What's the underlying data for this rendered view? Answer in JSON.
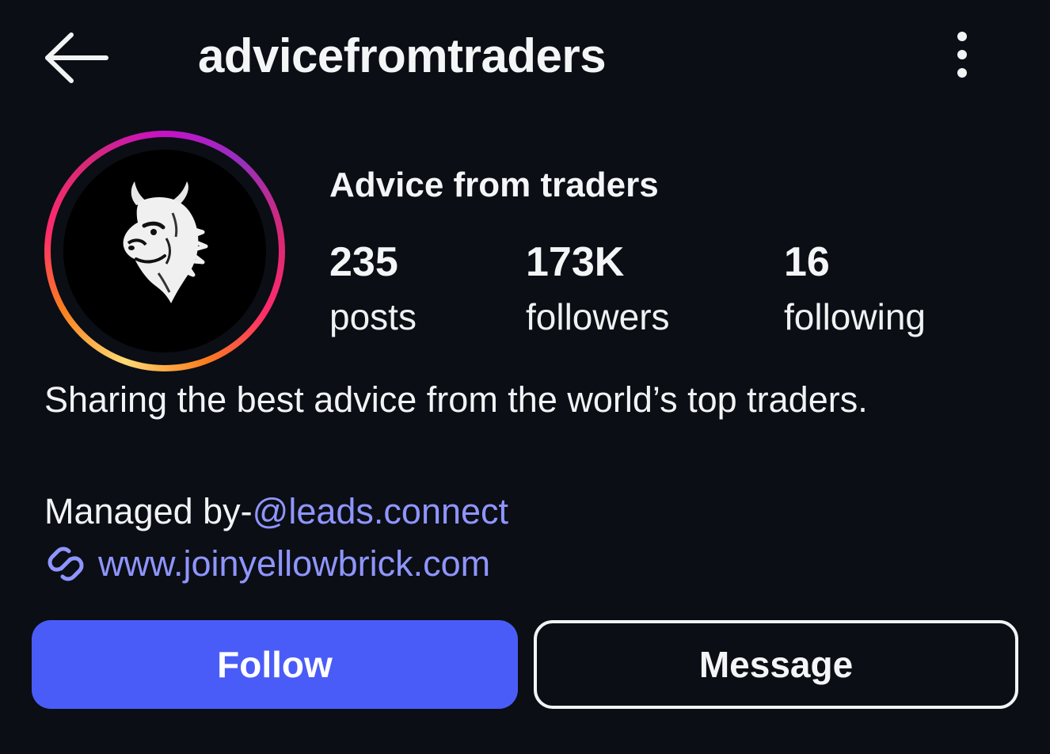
{
  "header": {
    "username": "advicefromtraders",
    "back_icon": "arrow-left-icon",
    "menu_icon": "more-vertical-icon"
  },
  "profile": {
    "display_name": "Advice from traders",
    "avatar_icon": "bull-logo-icon",
    "story_ring_colors": [
      "#feda75",
      "#fa7e1e",
      "#ff2a6d",
      "#d62976",
      "#c511c9"
    ],
    "stats": {
      "posts": {
        "value": "235",
        "label": "posts"
      },
      "followers": {
        "value": "173K",
        "label": "followers"
      },
      "following": {
        "value": "16",
        "label": "following"
      }
    },
    "bio": "Sharing the best advice from the world’s top traders.",
    "managed_prefix": "Managed by-",
    "managed_mention": "@leads.connect",
    "website": "www.joinyellowbrick.com",
    "website_icon": "link-icon"
  },
  "actions": {
    "follow_label": "Follow",
    "message_label": "Message"
  },
  "colors": {
    "background": "#0b0e14",
    "accent": "#4a5cf8",
    "link": "#8f95ff"
  }
}
